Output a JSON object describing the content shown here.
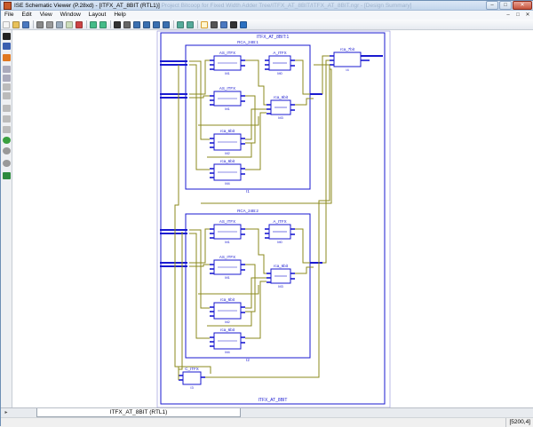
{
  "window": {
    "title": "ISE Schematic Viewer (P.28xd) - [ITFX_AT_8BIT (RTL1)]",
    "title_faded": "Project Bitcoop for Fixed Width Adder Tree/ITFX_AT_8BIT/ITFX_AT_8BIT.ngr - [Design Summary]",
    "minimize": "–",
    "maximize": "□",
    "close": "✕"
  },
  "menu": {
    "items": [
      "File",
      "Edit",
      "View",
      "Window",
      "Layout",
      "Help"
    ]
  },
  "toolbar": {
    "buttons": [
      "new-icon",
      "open-icon",
      "save-icon",
      "print-icon",
      "cut-icon",
      "copy-icon",
      "paste-icon",
      "delete-icon",
      "undo-icon",
      "redo-icon",
      "binoculars-icon",
      "find-icon",
      "zoom-in-icon",
      "zoom-out-icon",
      "zoom-fit-icon",
      "zoom-select-icon",
      "back-icon",
      "forward-icon",
      "schematic-icon",
      "select-icon",
      "pin-icon",
      "magnify-icon",
      "help-icon"
    ]
  },
  "left_toolbar": {
    "buttons": [
      "select-arrow-icon",
      "add-wire-icon",
      "orange-tool-icon",
      "hier-up-icon",
      "hier-down-icon",
      "page-prev-icon",
      "page-next-icon",
      "pan-icon",
      "print-preview-icon",
      "grid-icon",
      "green-add-icon",
      "gray-circle-icon",
      "refresh-icon",
      "shield-icon"
    ]
  },
  "schematic": {
    "top_title": "ITFX_AT_8BIT:1",
    "bottom_title": "ITFX_AT_8BIT",
    "colors": {
      "block": "#1a1ad0",
      "wire": "#8b8a1e",
      "bg": "#ffffff"
    },
    "final_adder": {
      "title": "rca_7bit",
      "inst": "I4"
    },
    "c_block": {
      "title": "C_ITFX",
      "inst": "I3"
    },
    "groups": [
      {
        "title": "RCA_24B:1",
        "inst": "I1",
        "blocks": [
          {
            "title": "AS_ITFX",
            "inst": "M1"
          },
          {
            "title": "A_ITFX",
            "inst": "M0"
          },
          {
            "title": "AS_ITFX",
            "inst": "M1"
          },
          {
            "title": "rca_6bit",
            "inst": "M3"
          },
          {
            "title": "rca_6bit",
            "inst": "M2"
          },
          {
            "title": "rca_6bit",
            "inst": "M4"
          }
        ]
      },
      {
        "title": "RCA_24B:2",
        "inst": "I2",
        "blocks": [
          {
            "title": "AS_ITFX",
            "inst": "M1"
          },
          {
            "title": "A_ITFX",
            "inst": "M0"
          },
          {
            "title": "AS_ITFX",
            "inst": "M1"
          },
          {
            "title": "rca_6bit",
            "inst": "M3"
          },
          {
            "title": "rca_6bit",
            "inst": "M2"
          },
          {
            "title": "rca_6bit",
            "inst": "M4"
          }
        ]
      }
    ]
  },
  "tabs": {
    "active": "ITFX_AT_8BIT (RTL1)"
  },
  "status": {
    "coords": "[5200,4]"
  }
}
